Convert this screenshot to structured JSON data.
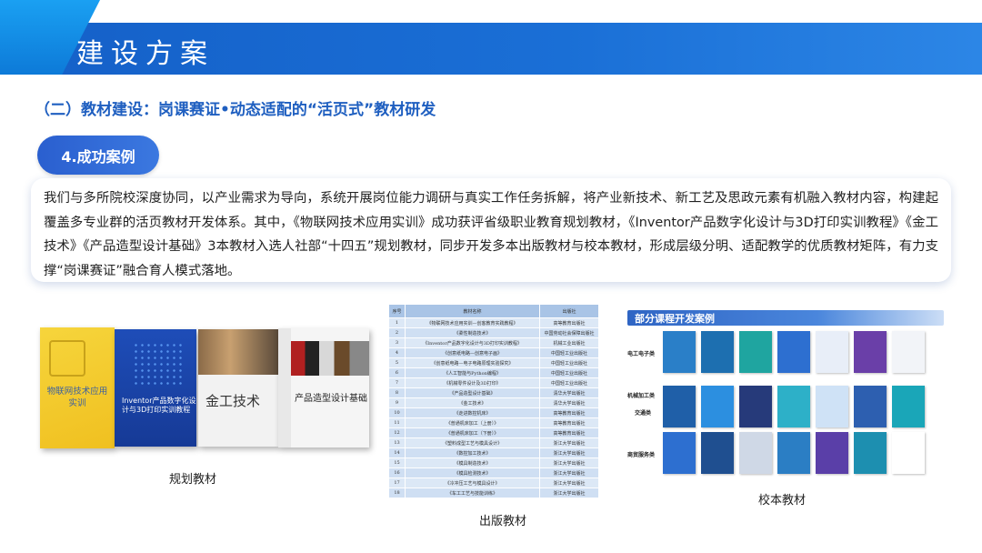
{
  "header": {
    "title": "建设方案"
  },
  "subtitle": "（二）教材建设：岗课赛证•动态适配的“活页式”教材研发",
  "section_pill": "4.成功案例",
  "body_text": "我们与多所院校深度协同，以产业需求为导向，系统开展岗位能力调研与真实工作任务拆解，将产业新技术、新工艺及思政元素有机融入教材内容，构建起覆盖多专业群的活页教材开发体系。其中，《物联网技术应用实训》成功获评省级职业教育规划教材，《Inventor产品数字化设计与3D打印实训教程》《金工技术》《产品造型设计基础》3本教材入选人社部“十四五”规划教材，同步开发多本出版教材与校本教材，形成层级分明、适配教学的优质教材矩阵，有力支撑“岗课赛证”融合育人模式落地。",
  "planned_books": {
    "caption": "规划教材",
    "books": [
      {
        "title": "物联网技术应用实训"
      },
      {
        "title": "Inventor产品数字化设计与3D打印实训教程"
      },
      {
        "title": "金工技术"
      },
      {
        "title": "产品造型设计基础"
      }
    ]
  },
  "published": {
    "caption": "出版教材",
    "headers": [
      "序号",
      "教材名称",
      "出版社"
    ],
    "rows": [
      [
        "1",
        "《物联网技术应用实训—创客教育实践教程》",
        "高等教育出版社"
      ],
      [
        "2",
        "《柔性制造技术》",
        "中国劳动社会保障出版社"
      ],
      [
        "3",
        "《Inventor产品数字化设计与3D打印实训教程》",
        "机械工业出版社"
      ],
      [
        "4",
        "《创意纸电路—创意电子画》",
        "中国轻工业出版社"
      ],
      [
        "5",
        "《创意纸电路—电子电路原理实验探究》",
        "中国轻工业出版社"
      ],
      [
        "6",
        "《人工智能与Python编程》",
        "中国轻工业出版社"
      ],
      [
        "7",
        "《机械零件设计及3D打印》",
        "中国轻工业出版社"
      ],
      [
        "8",
        "《产品造型设计基础》",
        "清华大学出版社"
      ],
      [
        "9",
        "《金工技术》",
        "清华大学出版社"
      ],
      [
        "10",
        "《走进数控机床》",
        "高等教育出版社"
      ],
      [
        "11",
        "《普通机床加工（上册）》",
        "高等教育出版社"
      ],
      [
        "12",
        "《普通机床加工（下册）》",
        "高等教育出版社"
      ],
      [
        "13",
        "《塑料成型工艺与模具设计》",
        "浙江大学出版社"
      ],
      [
        "14",
        "《数控加工技术》",
        "浙江大学出版社"
      ],
      [
        "15",
        "《模具制造技术》",
        "浙江大学出版社"
      ],
      [
        "16",
        "《模具检测技术》",
        "浙江大学出版社"
      ],
      [
        "17",
        "《冷冲压工艺与模具设计》",
        "浙江大学出版社"
      ],
      [
        "18",
        "《车工工艺与技能训练》",
        "浙江大学出版社"
      ]
    ]
  },
  "school_books": {
    "caption": "校本教材",
    "section_title": "部分课程开发案例",
    "categories": [
      "电工电子类",
      "机械加工类",
      "交通类",
      "商贸服务类"
    ],
    "cover_colors": [
      [
        "#2a7fc8",
        "#1d6fb0",
        "#1fa5a0",
        "#2d6fd0",
        "#e8eef8",
        "#6a3fa8",
        "#f2f4f8",
        "#3c7fd8"
      ],
      [
        "#1f5fa8",
        "#2c8fe0",
        "#263a7a",
        "#2db0c8",
        "#cfe2f6",
        "#2d5fb0",
        "#1aa6b8",
        "#2e6ec8"
      ],
      [
        "#2d6fd0",
        "#1f4f90",
        "#cfd8e6",
        "#2b7ec4",
        "#5a3fa8",
        "#1d8fb0",
        "#ffffff",
        "#234a9a"
      ]
    ]
  }
}
